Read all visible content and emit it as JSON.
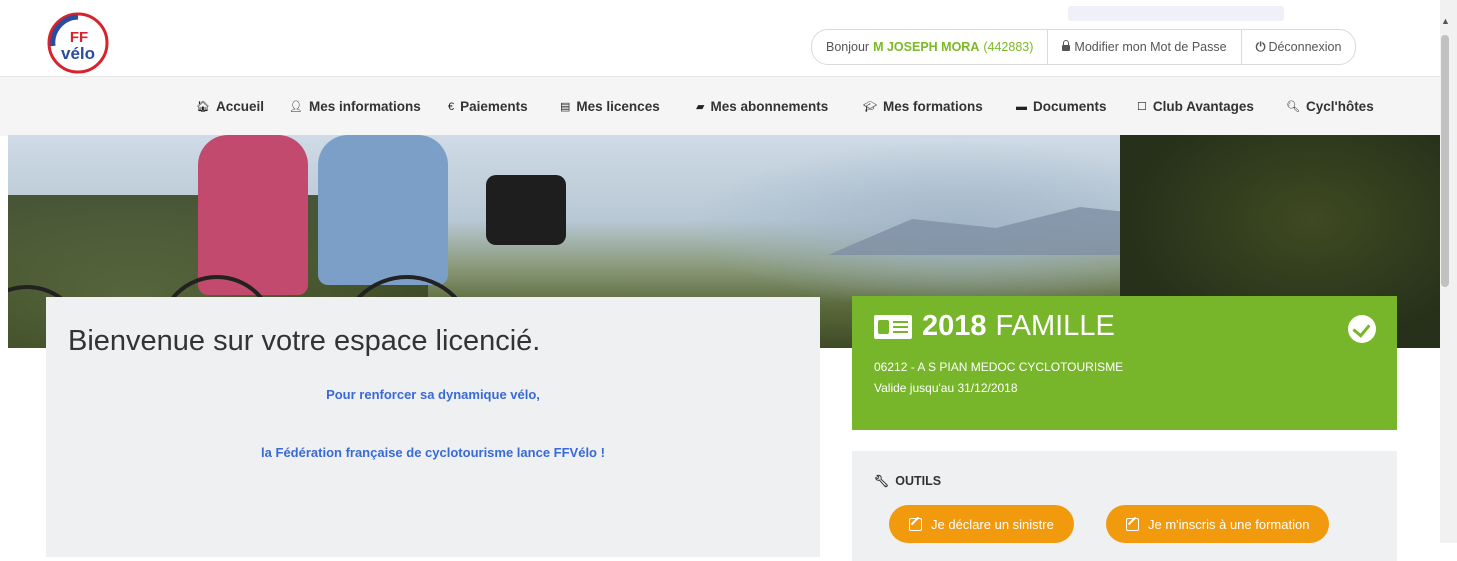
{
  "header": {
    "greeting_prefix": "Bonjour",
    "user_name": "M JOSEPH MORA",
    "user_id": "(442883)",
    "change_password_label": "Modifier mon Mot de Passe",
    "logout_label": "Déconnexion",
    "logo_text_top": "FF",
    "logo_text_bottom": "vélo"
  },
  "nav": {
    "items": [
      {
        "label": "Accueil",
        "icon": "home-icon"
      },
      {
        "label": "Mes informations",
        "icon": "user-icon"
      },
      {
        "label": "Paiements",
        "icon": "euro-icon"
      },
      {
        "label": "Mes licences",
        "icon": "id-card-icon"
      },
      {
        "label": "Mes abonnements",
        "icon": "book-icon"
      },
      {
        "label": "Mes formations",
        "icon": "graduation-cap-icon"
      },
      {
        "label": "Documents",
        "icon": "folder-icon"
      },
      {
        "label": "Club Avantages",
        "icon": "square-icon"
      },
      {
        "label": "Cycl'hôtes",
        "icon": "search-icon"
      }
    ]
  },
  "welcome": {
    "title": "Bienvenue sur votre espace licencié.",
    "line1": "Pour renforcer sa dynamique vélo,",
    "line2": "la Fédération française de cyclotourisme lance FFVélo !"
  },
  "license": {
    "year": "2018",
    "type": "FAMILLE",
    "club": "06212 - A S PIAN MEDOC CYCLOTOURISME",
    "valid_until": "Valide jusqu'au 31/12/2018",
    "status_icon": "check-circle-icon",
    "color": "#77b52a"
  },
  "tools": {
    "heading": "OUTILS",
    "buttons": [
      {
        "label": "Je déclare un sinistre"
      },
      {
        "label": "Je m'inscris à une formation"
      }
    ],
    "button_color": "#f29a0e"
  }
}
